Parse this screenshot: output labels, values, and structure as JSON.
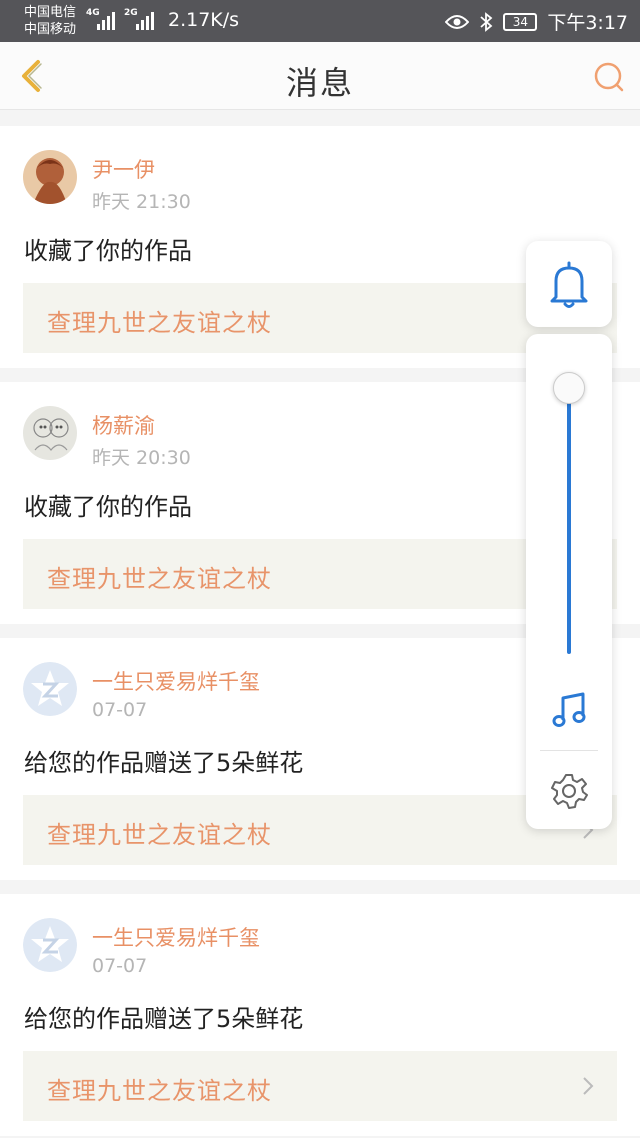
{
  "status_bar": {
    "carrier_1": "中国电信",
    "carrier_2": "中国移动",
    "net_1": "4G",
    "net_2": "2G",
    "speed": "2.17K/s",
    "battery": "34",
    "time": "下午3:17"
  },
  "nav": {
    "title": "消息",
    "back_icon": "back-chevron-icon",
    "search_icon": "search-icon",
    "accent_color": "#e8b13a"
  },
  "messages": [
    {
      "name": "尹一伊",
      "time": "昨天 21:30",
      "action": "收藏了你的作品",
      "work": "查理九世之友谊之杖",
      "avatar": "photo"
    },
    {
      "name": "杨薪渝",
      "time": "昨天 20:30",
      "action": "收藏了你的作品",
      "work": "查理九世之友谊之杖",
      "avatar": "sketch"
    },
    {
      "name": "一生只爱易烊千玺",
      "time": "07-07",
      "action": "给您的作品赠送了5朵鲜花",
      "work": "查理九世之友谊之杖",
      "avatar": "default"
    },
    {
      "name": "一生只爱易烊千玺",
      "time": "07-07",
      "action": "给您的作品赠送了5朵鲜花",
      "work": "查理九世之友谊之杖",
      "avatar": "default"
    }
  ],
  "volume_panel": {
    "level": 1.0,
    "bell_icon": "bell-icon",
    "music_icon": "music-note-icon",
    "settings_icon": "gear-icon",
    "track_color": "#2a79d4"
  }
}
